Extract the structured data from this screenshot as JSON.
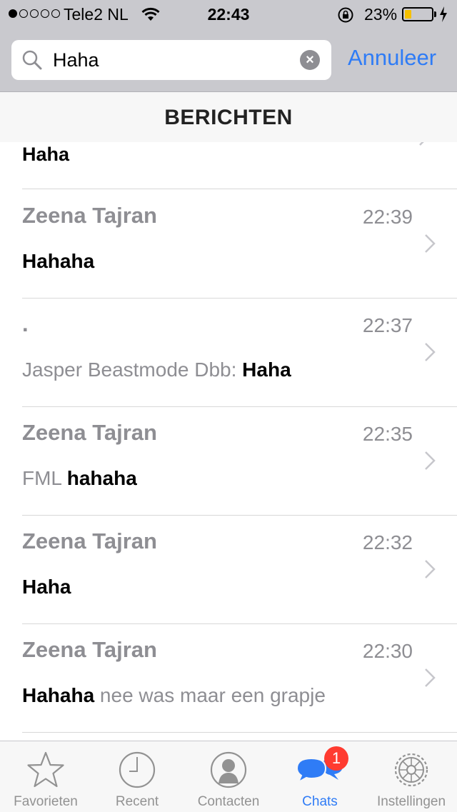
{
  "status_bar": {
    "carrier": "Tele2 NL",
    "time": "22:43",
    "battery_percent": "23%",
    "battery_level": 0.23,
    "signal_bars_filled": 1,
    "signal_bars_total": 5
  },
  "search": {
    "value": "Haha",
    "cancel_label": "Annuleer"
  },
  "section": {
    "title": "BERICHTEN"
  },
  "partial_row": {
    "message": "Haha"
  },
  "rows": [
    {
      "name": "Zeena Tajran",
      "time": "22:39",
      "prefix": "",
      "highlight": "Hahaha",
      "suffix": ""
    },
    {
      "name": ".",
      "time": "22:37",
      "prefix": "Jasper Beastmode Dbb: ",
      "highlight": "Haha",
      "suffix": ""
    },
    {
      "name": "Zeena Tajran",
      "time": "22:35",
      "prefix": "FML ",
      "highlight": "hahaha",
      "suffix": ""
    },
    {
      "name": "Zeena Tajran",
      "time": "22:32",
      "prefix": "",
      "highlight": "Haha",
      "suffix": ""
    },
    {
      "name": "Zeena Tajran",
      "time": "22:30",
      "prefix": "",
      "highlight": "Hahaha",
      "suffix": " nee was maar een grapje"
    }
  ],
  "tabs": [
    {
      "label": "Favorieten",
      "icon": "star-icon",
      "active": false
    },
    {
      "label": "Recent",
      "icon": "clock-icon",
      "active": false
    },
    {
      "label": "Contacten",
      "icon": "contact-icon",
      "active": false
    },
    {
      "label": "Chats",
      "icon": "chat-bubbles-icon",
      "active": true,
      "badge": "1"
    },
    {
      "label": "Instellingen",
      "icon": "gear-icon",
      "active": false
    }
  ],
  "colors": {
    "accent": "#2f7cf6",
    "badge": "#ff3b30",
    "battery_fill": "#f5c000",
    "secondary_text": "#8e8e93"
  }
}
